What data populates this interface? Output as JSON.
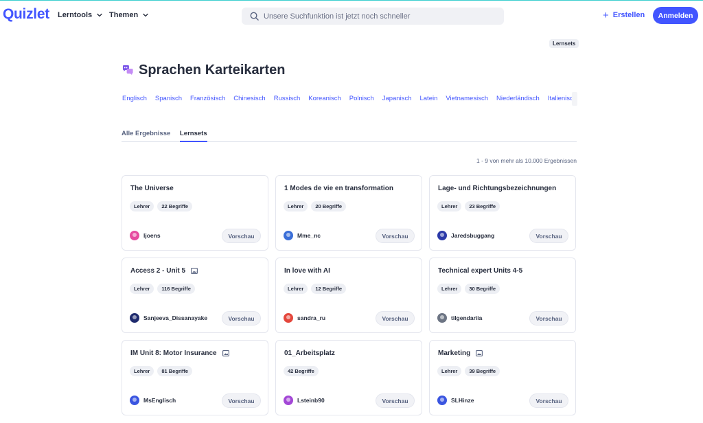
{
  "header": {
    "logo": "Quizlet",
    "nav": [
      {
        "label": "Lerntools"
      },
      {
        "label": "Themen"
      }
    ],
    "search_placeholder": "Unsere Suchfunktion ist jetzt noch schneller",
    "create_label": "Erstellen",
    "login_label": "Anmelden",
    "accent": "#4255ff"
  },
  "page": {
    "breadcrumb_badge": "Lernsets",
    "title": "Sprachen Karteikarten",
    "title_icon": "speech-bubbles-icon",
    "language_chips": [
      "Englisch",
      "Spanisch",
      "Französisch",
      "Chinesisch",
      "Russisch",
      "Koreanisch",
      "Polnisch",
      "Japanisch",
      "Latein",
      "Vietnamesisch",
      "Niederländisch",
      "Italienisch"
    ],
    "tabs": [
      {
        "label": "Alle Ergebnisse",
        "active": false
      },
      {
        "label": "Lernsets",
        "active": true
      }
    ],
    "results_text": "1 - 9 von mehr als 10.000 Ergebnissen"
  },
  "cards": [
    {
      "title": "The Universe",
      "has_image": false,
      "badge": "Lehrer",
      "terms": "22 Begriffe",
      "author": "ljoens",
      "avatar_color": "#e64ba0",
      "preview": "Vorschau"
    },
    {
      "title": "1 Modes de vie en transformation",
      "has_image": false,
      "badge": "Lehrer",
      "terms": "20 Begriffe",
      "author": "Mme_nc",
      "avatar_color": "#3b6fd8",
      "preview": "Vorschau"
    },
    {
      "title": "Lage- und Richtungsbezeichnungen",
      "has_image": false,
      "badge": "Lehrer",
      "terms": "23 Begriffe",
      "author": "Jaredsbuggang",
      "avatar_color": "#2c3aa8",
      "preview": "Vorschau"
    },
    {
      "title": "Access 2 - Unit 5",
      "has_image": true,
      "badge": "Lehrer",
      "terms": "116 Begriffe",
      "author": "Sanjeeva_Dissanayake",
      "avatar_color": "#1f2b6e",
      "preview": "Vorschau"
    },
    {
      "title": "In love with AI",
      "has_image": false,
      "badge": "Lehrer",
      "terms": "12 Begriffe",
      "author": "sandra_ru",
      "avatar_color": "#e4473c",
      "preview": "Vorschau"
    },
    {
      "title": "Technical expert Units 4-5",
      "has_image": false,
      "badge": "Lehrer",
      "terms": "30 Begriffe",
      "author": "tilgendariia",
      "avatar_color": "#6d7584",
      "preview": "Vorschau"
    },
    {
      "title": "IM Unit 8: Motor Insurance",
      "has_image": true,
      "badge": "Lehrer",
      "terms": "81 Begriffe",
      "author": "MsEnglisch",
      "avatar_color": "#3a55e0",
      "preview": "Vorschau"
    },
    {
      "title": "01_Arbeitsplatz",
      "has_image": false,
      "badge": null,
      "terms": "42 Begriffe",
      "author": "Lsteinb90",
      "avatar_color": "#a347d6",
      "preview": "Vorschau"
    },
    {
      "title": "Marketing",
      "has_image": true,
      "badge": "Lehrer",
      "terms": "39 Begriffe",
      "author": "SLHinze",
      "avatar_color": "#3a55e0",
      "preview": "Vorschau"
    }
  ]
}
